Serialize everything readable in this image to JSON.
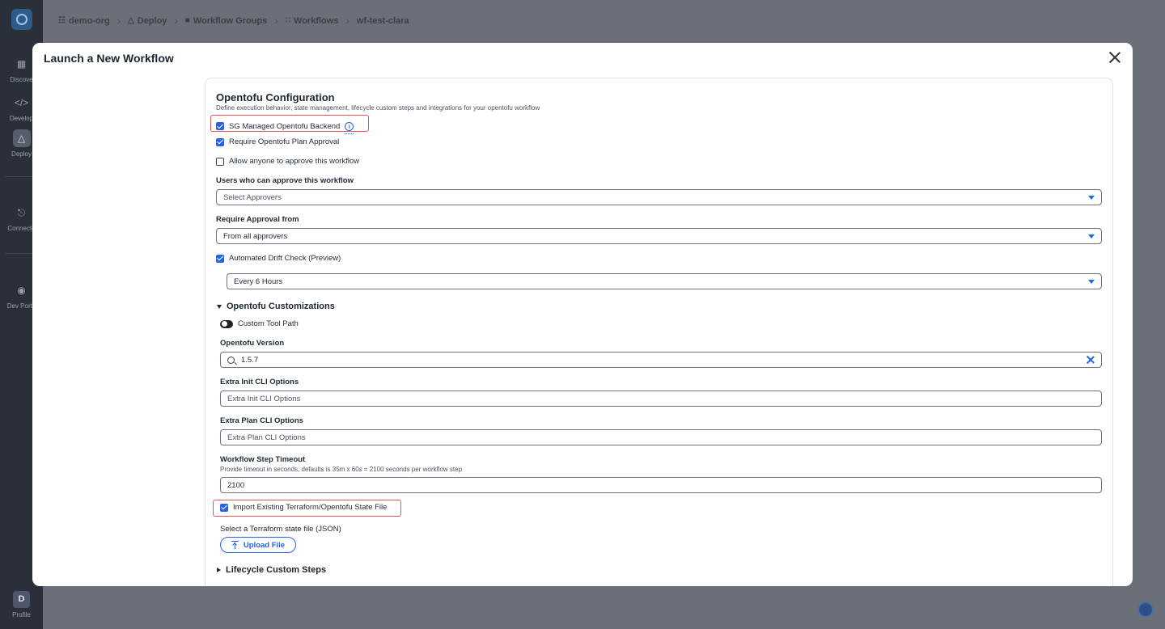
{
  "breadcrumb": {
    "items": [
      "demo-org",
      "Deploy",
      "Workflow Groups",
      "Workflows",
      "wf-test-clara"
    ]
  },
  "rail": {
    "items": [
      "Discove",
      "Develop",
      "Deploy",
      "Connecto",
      "Dev Porta"
    ],
    "profile_initial": "D",
    "profile_label": "Profile"
  },
  "modal": {
    "title": "Launch a New Workflow"
  },
  "config": {
    "title": "Opentofu Configuration",
    "subtitle": "Define execution behavior, state management, lifecycle custom steps and integrations for your opentofu workflow",
    "sg_backend": {
      "label": "SG Managed Opentofu Backend",
      "checked": true
    },
    "plan_approval": {
      "label": "Require Opentofu Plan Approval",
      "checked": true
    },
    "anyone_approve": {
      "label": "Allow anyone to approve this workflow",
      "checked": false
    },
    "approvers": {
      "label": "Users who can approve this workflow",
      "placeholder": "Select Approvers"
    },
    "approval_from": {
      "label": "Require Approval from",
      "value": "From all approvers"
    },
    "drift_check": {
      "label": "Automated Drift Check (Preview)",
      "checked": true,
      "value": "Every 6 Hours"
    },
    "customizations": {
      "title": "Opentofu Customizations",
      "expanded": true,
      "custom_tool_path": "Custom Tool Path",
      "version": {
        "label": "Opentofu Version",
        "value": "1.5.7"
      },
      "init_opts": {
        "label": "Extra Init CLI Options",
        "placeholder": "Extra Init CLI Options"
      },
      "plan_opts": {
        "label": "Extra Plan CLI Options",
        "placeholder": "Extra Plan CLI Options"
      },
      "timeout": {
        "label": "Workflow Step Timeout",
        "help": "Provide timeout in seconds, defaults is 35m x 60s = 2100 seconds per workflow step",
        "value": "2100"
      },
      "import_state": {
        "label": "Import Existing Terraform/Opentofu State File",
        "checked": true
      },
      "state_file_label": "Select a Terraform state file (JSON)",
      "upload_label": "Upload File"
    },
    "lifecycle": {
      "title": "Lifecycle Custom Steps",
      "expanded": false
    }
  },
  "colors": {
    "accent": "#2563eb",
    "highlight": "#e05555",
    "rail": "#2a2f3a",
    "overlay": "#6b6f78"
  }
}
